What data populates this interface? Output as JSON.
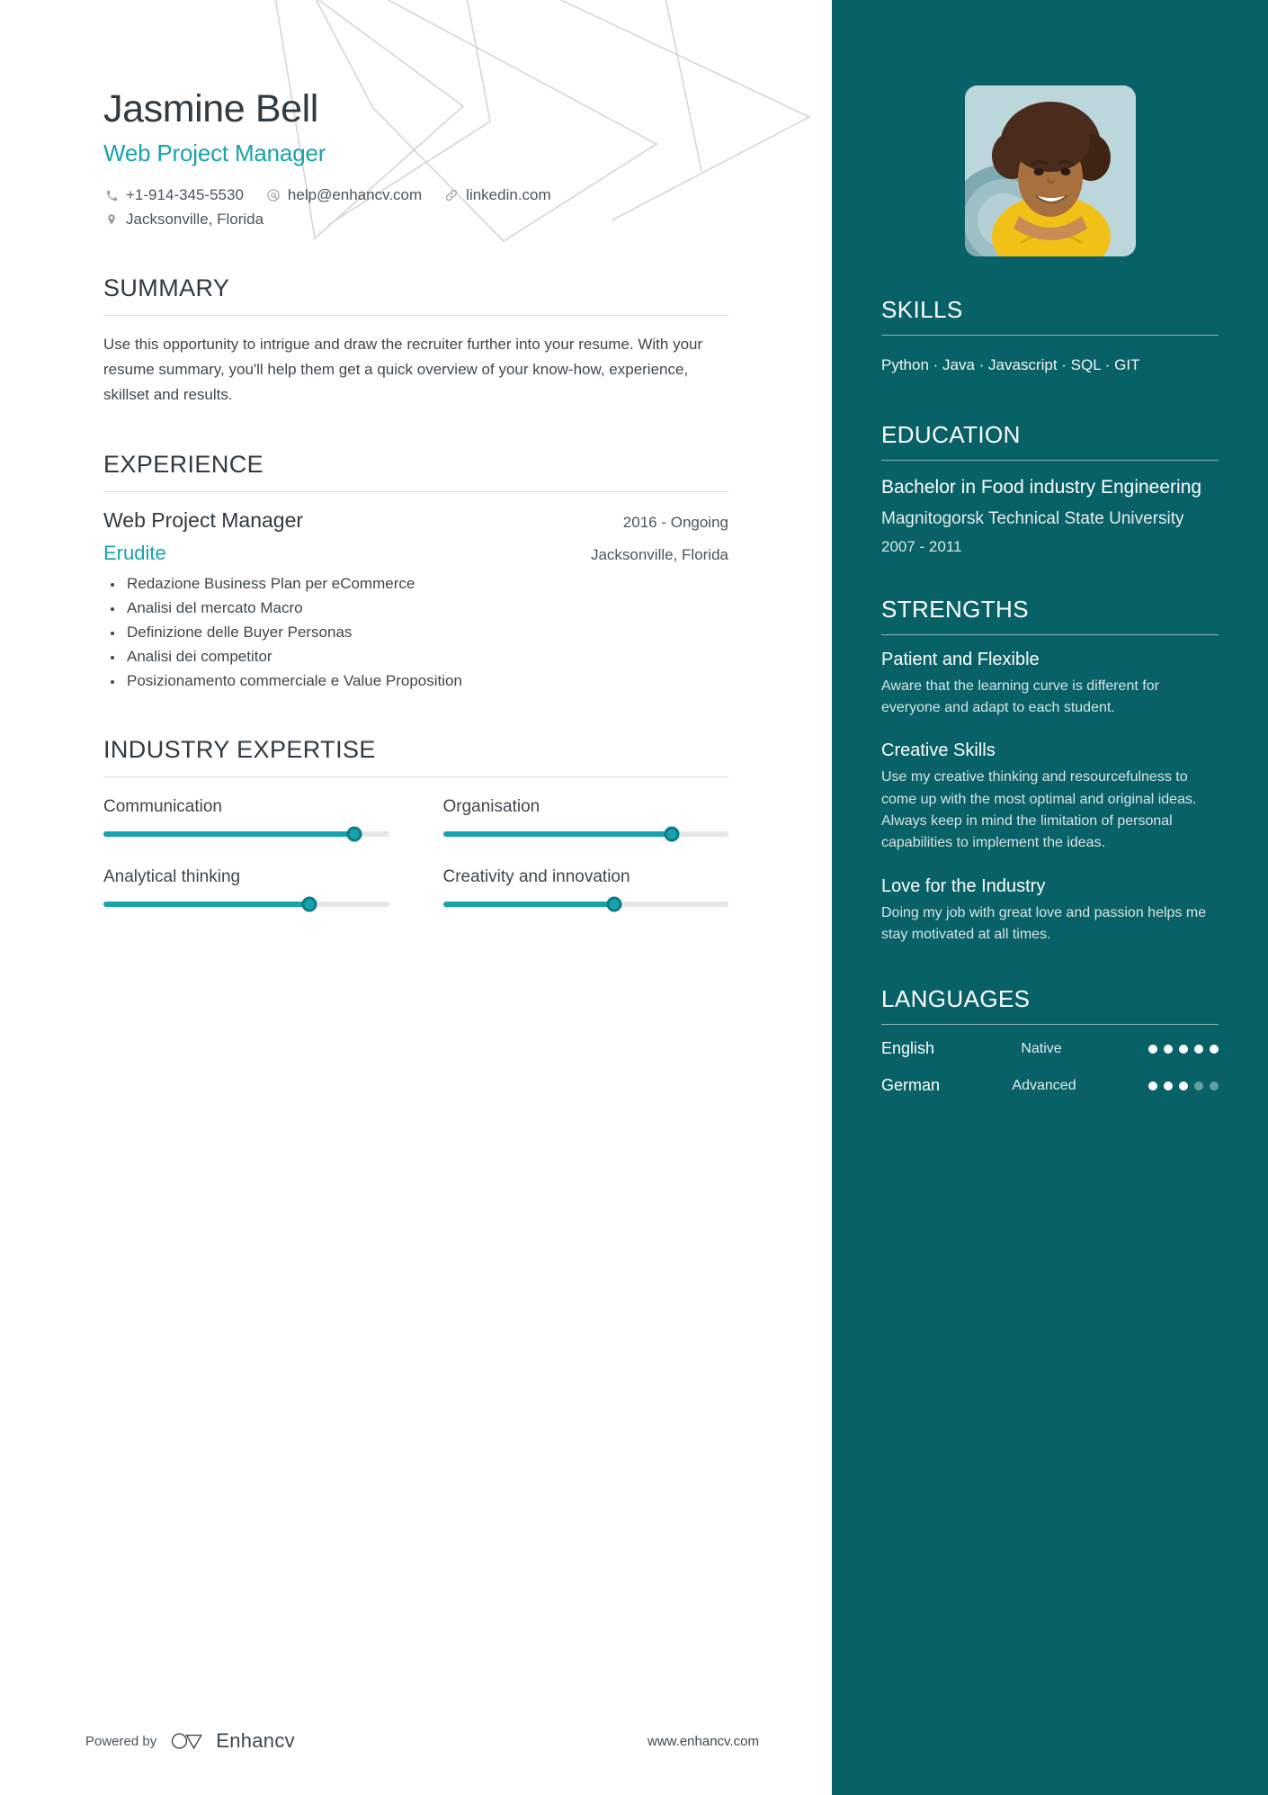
{
  "header": {
    "name": "Jasmine Bell",
    "role": "Web Project Manager",
    "contacts": [
      {
        "icon": "phone-icon",
        "text": "+1-914-345-5530"
      },
      {
        "icon": "email-icon",
        "text": "help@enhancv.com"
      },
      {
        "icon": "link-icon",
        "text": "linkedin.com"
      }
    ],
    "location": {
      "icon": "location-pin-icon",
      "text": "Jacksonville, Florida"
    }
  },
  "summary": {
    "title": "SUMMARY",
    "text": "Use this opportunity to intrigue and draw the recruiter further into your resume. With your resume summary, you'll help them get a quick overview of your know-how, experience, skillset and results."
  },
  "experience": {
    "title": "EXPERIENCE",
    "entries": [
      {
        "job_title": "Web Project Manager",
        "dates": "2016 - Ongoing",
        "company": "Erudite",
        "location": "Jacksonville, Florida",
        "bullets": [
          "Redazione Business Plan per eCommerce",
          "Analisi del mercato Macro",
          "Definizione delle Buyer Personas",
          "Analisi dei competitor",
          "Posizionamento commerciale e Value Proposition"
        ]
      }
    ]
  },
  "industry_expertise": {
    "title": "INDUSTRY EXPERTISE",
    "items": [
      {
        "label": "Communication",
        "value": 88
      },
      {
        "label": "Organisation",
        "value": 80
      },
      {
        "label": "Analytical thinking",
        "value": 72
      },
      {
        "label": "Creativity and innovation",
        "value": 60
      }
    ]
  },
  "skills": {
    "title": "SKILLS",
    "text": "Python · Java · Javascript · SQL · GIT"
  },
  "education": {
    "title": "EDUCATION",
    "entries": [
      {
        "degree": "Bachelor in Food industry Engineering",
        "school": "Magnitogorsk Technical State University",
        "dates": "2007 - 2011"
      }
    ]
  },
  "strengths": {
    "title": "STRENGTHS",
    "items": [
      {
        "name": "Patient and Flexible",
        "description": "Aware that the learning curve is different for everyone and adapt to each student."
      },
      {
        "name": "Creative Skills",
        "description": "Use my creative thinking and resourcefulness to come up with the most optimal and original ideas. Always keep in mind the limitation of personal capabilities to implement the ideas."
      },
      {
        "name": "Love for the Industry",
        "description": "Doing my job with great love and passion helps me stay motivated at all times."
      }
    ]
  },
  "languages": {
    "title": "LANGUAGES",
    "items": [
      {
        "name": "English",
        "level": "Native",
        "dots_filled": 5,
        "dots_total": 5
      },
      {
        "name": "German",
        "level": "Advanced",
        "dots_filled": 3,
        "dots_total": 5
      }
    ]
  },
  "footer": {
    "powered_by": "Powered by",
    "brand": "Enhancv",
    "website": "www.enhancv.com"
  },
  "colors": {
    "accent": "#17a3ab",
    "sidebar": "#086166",
    "text": "#3d474f",
    "heading": "#2f3a43"
  }
}
